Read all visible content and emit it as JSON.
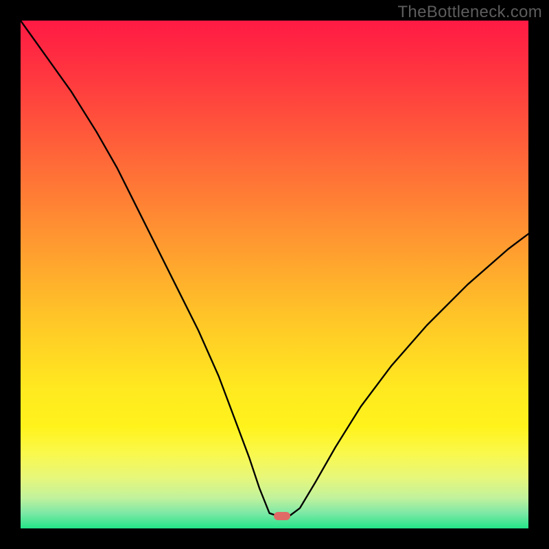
{
  "watermark": {
    "text": "TheBottleneck.com"
  },
  "gradient": {
    "stops": [
      "#ff1a44",
      "#ff3a3f",
      "#ff6a38",
      "#ff9a30",
      "#ffc428",
      "#ffe820",
      "#fff31c",
      "#faf84a",
      "#e7f77a",
      "#c1f29c",
      "#7de8a6",
      "#23e589"
    ]
  },
  "marker": {
    "color": "#e06a66",
    "x_frac": 0.515,
    "y_frac": 0.975
  },
  "chart_data": {
    "type": "line",
    "title": "",
    "xlabel": "",
    "ylabel": "",
    "xlim": [
      0,
      100
    ],
    "ylim": [
      0,
      100
    ],
    "annotations": [
      "TheBottleneck.com"
    ],
    "description": "Bottleneck percentage curve with a V-shaped minimum over a red→green vertical gradient indicating bottleneck severity (red high, green low). Marker indicates optimal point near the curve's minimum.",
    "series": [
      {
        "name": "bottleneck-curve",
        "x": [
          0,
          5,
          10,
          15,
          19,
          23,
          27,
          31,
          35,
          39,
          42,
          45,
          47,
          49,
          50.5,
          53,
          55,
          58,
          62,
          67,
          73,
          80,
          88,
          96,
          100
        ],
        "y": [
          100,
          93,
          86,
          78,
          71,
          63,
          55,
          47,
          39,
          30,
          22,
          14,
          8,
          3,
          2.5,
          2.5,
          4,
          9,
          16,
          24,
          32,
          40,
          48,
          55,
          58
        ]
      }
    ],
    "optimal_point": {
      "x": 51.5,
      "y": 2.5
    }
  }
}
